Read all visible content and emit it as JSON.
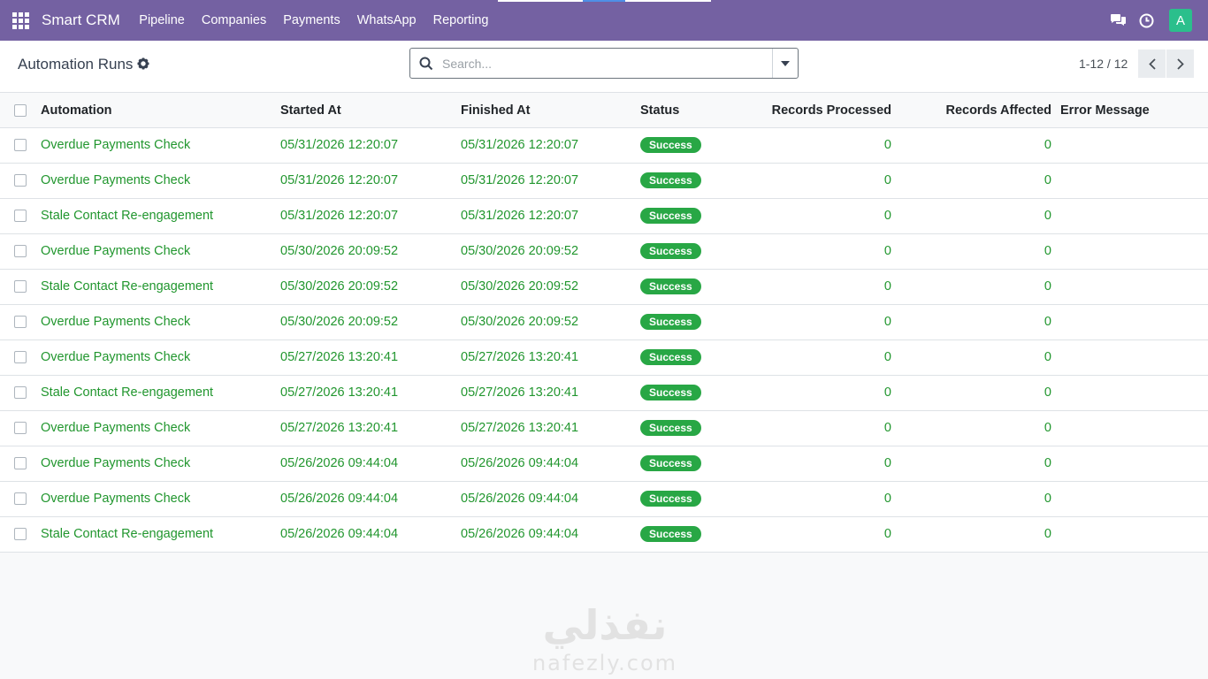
{
  "nav": {
    "brand": "Smart CRM",
    "items": [
      {
        "label": "Pipeline"
      },
      {
        "label": "Companies"
      },
      {
        "label": "Payments"
      },
      {
        "label": "WhatsApp"
      },
      {
        "label": "Reporting"
      }
    ],
    "avatar_initial": "A",
    "colors": {
      "navbar": "#7461a2",
      "avatar": "#2bbf8c"
    },
    "icons": [
      "apps-grid-icon",
      "chat-icon",
      "clock-icon"
    ]
  },
  "control": {
    "title": "Automation Runs",
    "search_placeholder": "Search...",
    "pager": "1-12 / 12"
  },
  "table": {
    "columns": {
      "automation": "Automation",
      "started": "Started At",
      "finished": "Finished At",
      "status": "Status",
      "processed": "Records Processed",
      "affected": "Records Affected",
      "error": "Error Message"
    },
    "rows": [
      {
        "automation": "Overdue Payments Check",
        "started": "05/31/2026 12:20:07",
        "finished": "05/31/2026 12:20:07",
        "status": "Success",
        "processed": "0",
        "affected": "0",
        "error": ""
      },
      {
        "automation": "Overdue Payments Check",
        "started": "05/31/2026 12:20:07",
        "finished": "05/31/2026 12:20:07",
        "status": "Success",
        "processed": "0",
        "affected": "0",
        "error": ""
      },
      {
        "automation": "Stale Contact Re-engagement",
        "started": "05/31/2026 12:20:07",
        "finished": "05/31/2026 12:20:07",
        "status": "Success",
        "processed": "0",
        "affected": "0",
        "error": ""
      },
      {
        "automation": "Overdue Payments Check",
        "started": "05/30/2026 20:09:52",
        "finished": "05/30/2026 20:09:52",
        "status": "Success",
        "processed": "0",
        "affected": "0",
        "error": ""
      },
      {
        "automation": "Stale Contact Re-engagement",
        "started": "05/30/2026 20:09:52",
        "finished": "05/30/2026 20:09:52",
        "status": "Success",
        "processed": "0",
        "affected": "0",
        "error": ""
      },
      {
        "automation": "Overdue Payments Check",
        "started": "05/30/2026 20:09:52",
        "finished": "05/30/2026 20:09:52",
        "status": "Success",
        "processed": "0",
        "affected": "0",
        "error": ""
      },
      {
        "automation": "Overdue Payments Check",
        "started": "05/27/2026 13:20:41",
        "finished": "05/27/2026 13:20:41",
        "status": "Success",
        "processed": "0",
        "affected": "0",
        "error": ""
      },
      {
        "automation": "Stale Contact Re-engagement",
        "started": "05/27/2026 13:20:41",
        "finished": "05/27/2026 13:20:41",
        "status": "Success",
        "processed": "0",
        "affected": "0",
        "error": ""
      },
      {
        "automation": "Overdue Payments Check",
        "started": "05/27/2026 13:20:41",
        "finished": "05/27/2026 13:20:41",
        "status": "Success",
        "processed": "0",
        "affected": "0",
        "error": ""
      },
      {
        "automation": "Overdue Payments Check",
        "started": "05/26/2026 09:44:04",
        "finished": "05/26/2026 09:44:04",
        "status": "Success",
        "processed": "0",
        "affected": "0",
        "error": ""
      },
      {
        "automation": "Overdue Payments Check",
        "started": "05/26/2026 09:44:04",
        "finished": "05/26/2026 09:44:04",
        "status": "Success",
        "processed": "0",
        "affected": "0",
        "error": ""
      },
      {
        "automation": "Stale Contact Re-engagement",
        "started": "05/26/2026 09:44:04",
        "finished": "05/26/2026 09:44:04",
        "status": "Success",
        "processed": "0",
        "affected": "0",
        "error": ""
      }
    ],
    "colors": {
      "row_text": "#21962e",
      "badge": "#28a745"
    }
  },
  "watermark": {
    "arabic": "نفذلي",
    "latin": "nafezly.com"
  }
}
